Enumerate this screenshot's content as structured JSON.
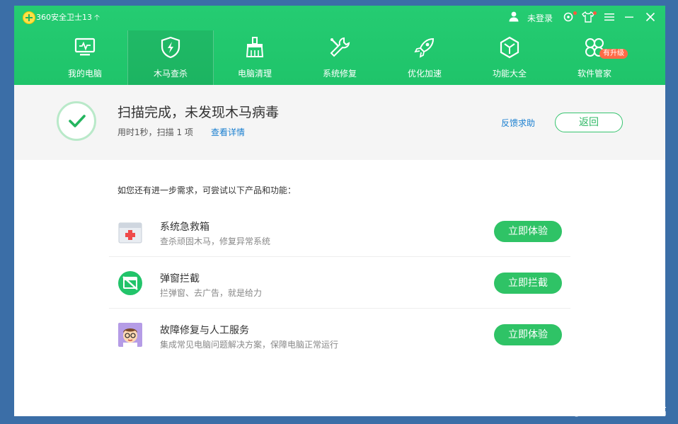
{
  "titlebar": {
    "app_title": "360安全卫士13",
    "user_label": "未登录"
  },
  "nav": {
    "items": [
      {
        "label": "我的电脑",
        "icon": "monitor-icon"
      },
      {
        "label": "木马查杀",
        "icon": "shield-icon"
      },
      {
        "label": "电脑清理",
        "icon": "broom-icon"
      },
      {
        "label": "系统修复",
        "icon": "wrench-icon"
      },
      {
        "label": "优化加速",
        "icon": "rocket-icon"
      },
      {
        "label": "功能大全",
        "icon": "cube-icon"
      },
      {
        "label": "软件管家",
        "icon": "flower-icon",
        "badge": "有升级"
      }
    ],
    "active_index": 1
  },
  "result": {
    "title": "扫描完成，未发现木马病毒",
    "summary": "用时1秒，扫描  1  项",
    "details_link": "查看详情",
    "feedback_link": "反馈求助",
    "back_button": "返回"
  },
  "suggestions": {
    "intro": "如您还有进一步需求，可尝试以下产品和功能：",
    "items": [
      {
        "title": "系统急救箱",
        "desc": "查杀顽固木马，修复异常系统",
        "button": "立即体验",
        "icon": "first-aid-kit-icon"
      },
      {
        "title": "弹窗拦截",
        "desc": "拦弹窗、去广告，就是给力",
        "button": "立即拦截",
        "icon": "popup-block-icon"
      },
      {
        "title": "故障修复与人工服务",
        "desc": "集成常见电脑问题解决方案，保障电脑正常运行",
        "button": "立即体验",
        "icon": "technician-avatar-icon"
      }
    ]
  },
  "watermark": "CSDN @小哥们肩膀一般高",
  "colors": {
    "header_green": "#1fc46a",
    "button_green": "#2fc366",
    "link_blue": "#1a7fd0",
    "badge_orange": "#ff6a47",
    "desktop_blue": "#3b6ea7"
  }
}
